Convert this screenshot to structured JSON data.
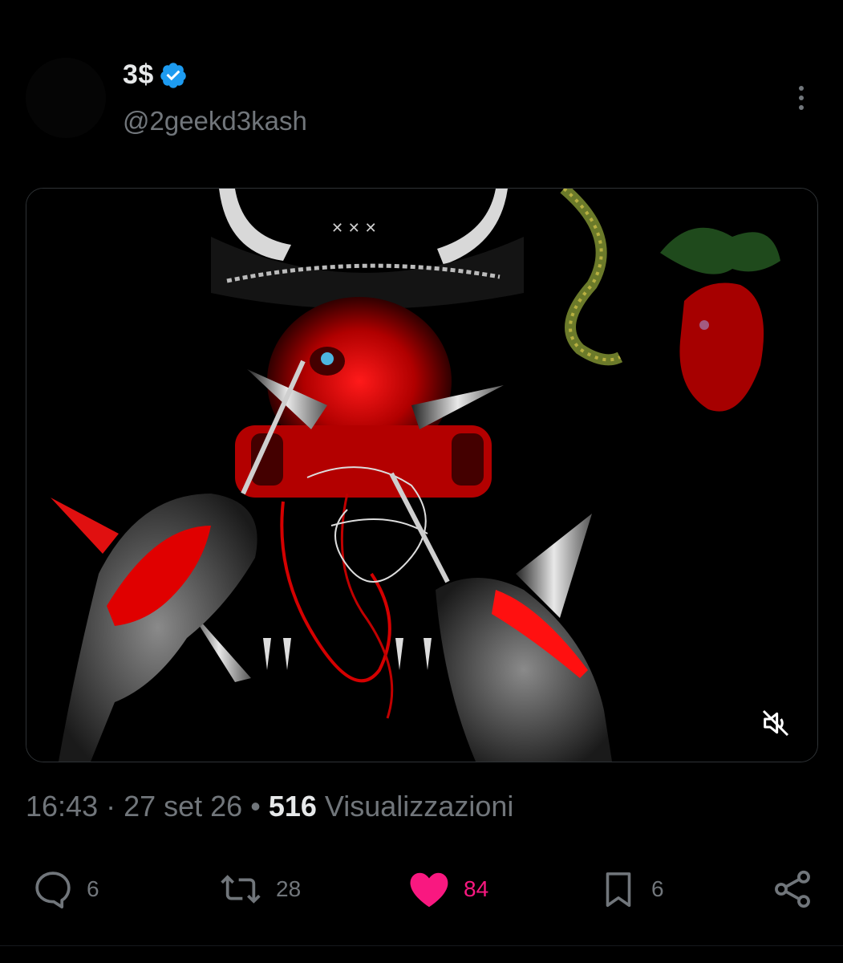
{
  "user": {
    "display_name": "3$",
    "handle": "@2geekd3kash",
    "verified_icon": "verified-badge-icon",
    "verified_color": "#1d9bf0"
  },
  "media": {
    "type": "image",
    "mute_icon": "muted-speaker-icon"
  },
  "meta": {
    "time": "16:43",
    "sep1": " · ",
    "date": "27 set 26",
    "sep2": " • ",
    "views_count": "516",
    "views_label": " Visualizzazioni"
  },
  "actions": {
    "reply": {
      "icon": "reply-icon",
      "count": "6"
    },
    "repost": {
      "icon": "repost-icon",
      "count": "28"
    },
    "like": {
      "icon": "heart-icon",
      "count": "84",
      "active": true,
      "color": "#f91880"
    },
    "bookmark": {
      "icon": "bookmark-icon",
      "count": "6"
    },
    "share": {
      "icon": "share-icon"
    }
  },
  "colors": {
    "background": "#000000",
    "text_primary": "#e7e9ea",
    "text_secondary": "#71767b",
    "accent_blue": "#1d9bf0",
    "like_pink": "#f91880"
  }
}
